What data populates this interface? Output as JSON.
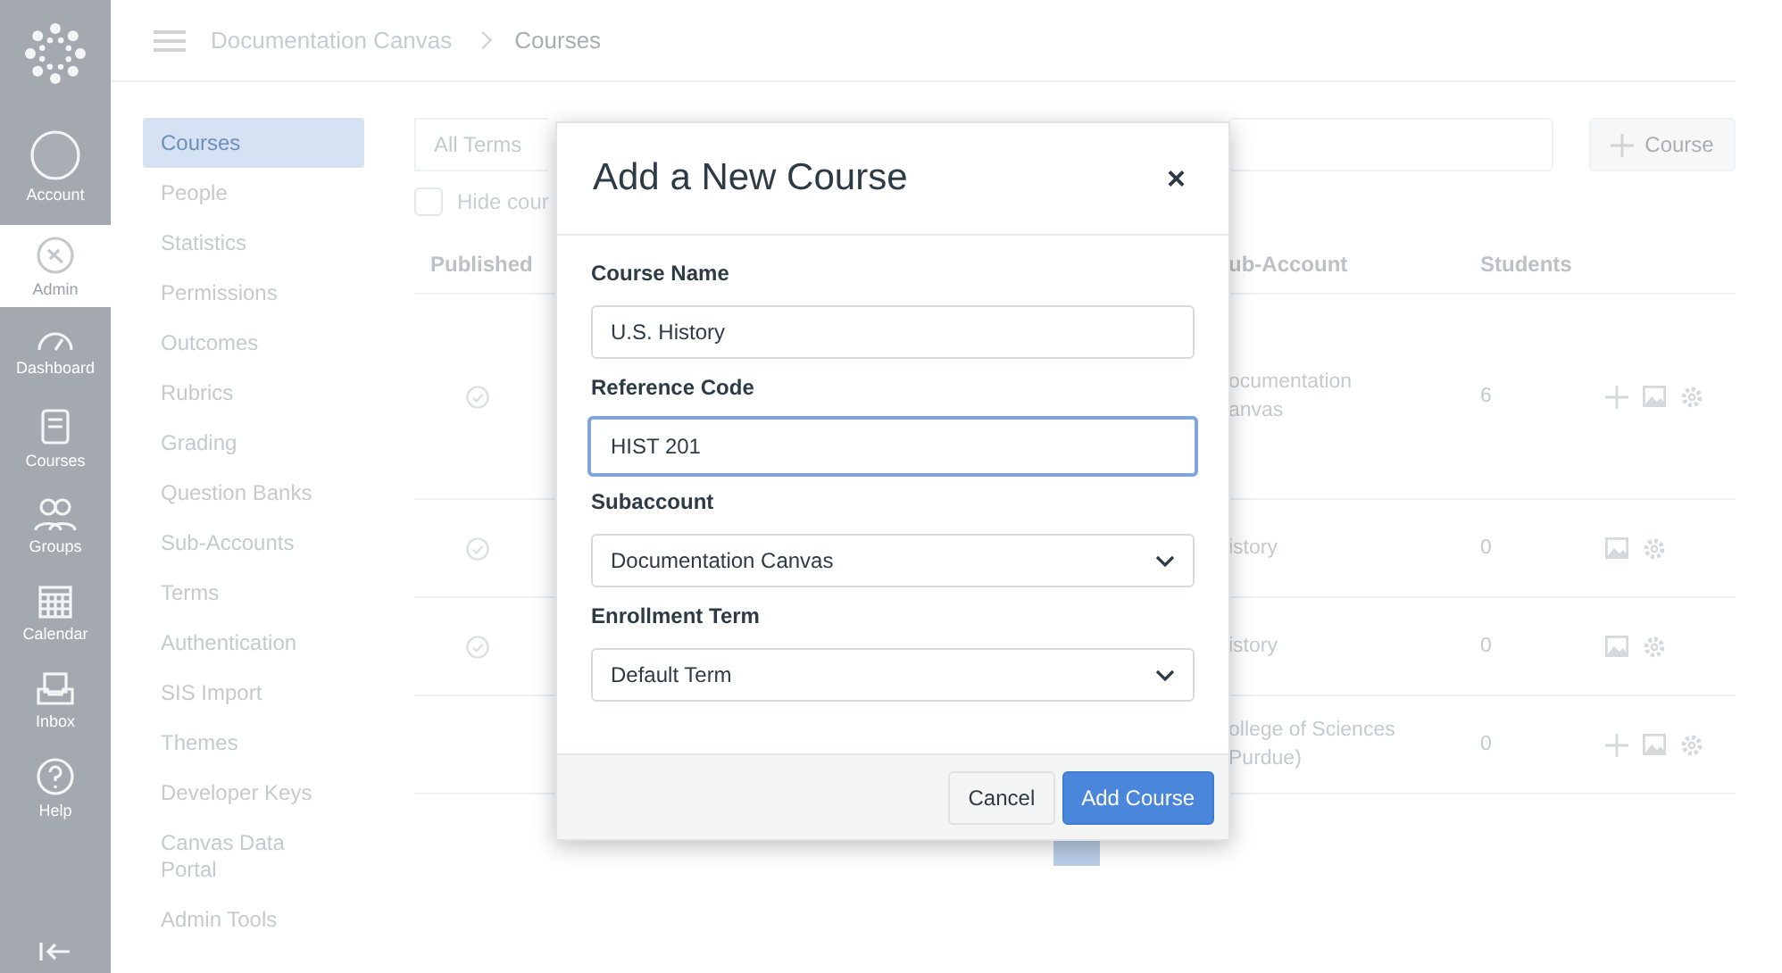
{
  "global_nav": {
    "items": [
      {
        "kind": "logo",
        "selected": false
      },
      {
        "kind": "account",
        "label": "Account",
        "selected": false
      },
      {
        "kind": "admin",
        "label": "Admin",
        "selected": true
      },
      {
        "kind": "dashboard",
        "label": "Dashboard",
        "selected": false
      },
      {
        "kind": "courses",
        "label": "Courses",
        "selected": false
      },
      {
        "kind": "groups",
        "label": "Groups",
        "selected": false
      },
      {
        "kind": "calendar",
        "label": "Calendar",
        "selected": false
      },
      {
        "kind": "inbox",
        "label": "Inbox",
        "selected": false
      },
      {
        "kind": "help",
        "label": "Help",
        "selected": false
      },
      {
        "kind": "collapse",
        "selected": false
      }
    ]
  },
  "breadcrumb": [
    "Documentation Canvas",
    "Courses"
  ],
  "sub_nav": {
    "items": [
      {
        "label": "Courses",
        "selected": true
      },
      {
        "label": "People",
        "selected": false
      },
      {
        "label": "Statistics",
        "selected": false
      },
      {
        "label": "Permissions",
        "selected": false
      },
      {
        "label": "Outcomes",
        "selected": false
      },
      {
        "label": "Rubrics",
        "selected": false
      },
      {
        "label": "Grading",
        "selected": false
      },
      {
        "label": "Question Banks",
        "selected": false
      },
      {
        "label": "Sub-Accounts",
        "selected": false
      },
      {
        "label": "Terms",
        "selected": false
      },
      {
        "label": "Authentication",
        "selected": false
      },
      {
        "label": "SIS Import",
        "selected": false
      },
      {
        "label": "Themes",
        "selected": false
      },
      {
        "label": "Developer Keys",
        "selected": false
      },
      {
        "label": "Canvas Data Portal",
        "selected": false
      },
      {
        "label": "Admin Tools",
        "selected": false
      }
    ]
  },
  "filters": {
    "term_select": "All Terms",
    "hide_checkbox": {
      "label": "Hide cour",
      "checked": false
    },
    "add_button": "Course"
  },
  "table": {
    "columns": [
      "Published",
      "ub-Account",
      "Students"
    ],
    "rows": [
      {
        "published": true,
        "sub_account": [
          "ocumentation",
          "anvas"
        ],
        "students": "6",
        "actions": [
          {
            "kind": "add"
          },
          {
            "kind": "image"
          },
          {
            "kind": "settings"
          }
        ]
      },
      {
        "published": true,
        "sub_account": [
          "istory"
        ],
        "students": "0",
        "actions": [
          {
            "kind": "image"
          },
          {
            "kind": "settings"
          }
        ]
      },
      {
        "published": true,
        "sub_account": [
          "istory"
        ],
        "students": "0",
        "actions": [
          {
            "kind": "image"
          },
          {
            "kind": "settings"
          }
        ]
      },
      {
        "published": false,
        "sub_account": [
          "ollege of Sciences",
          "Purdue)"
        ],
        "students": "0",
        "actions": [
          {
            "kind": "add"
          },
          {
            "kind": "image"
          },
          {
            "kind": "settings"
          }
        ]
      }
    ]
  },
  "modal": {
    "title": "Add a New Course",
    "close": "×",
    "fields": [
      {
        "label": "Course Name",
        "kind": "text",
        "value": "U.S. History",
        "focused": false
      },
      {
        "label": "Reference Code",
        "kind": "text",
        "value": "HIST 201",
        "focused": true
      },
      {
        "label": "Subaccount",
        "kind": "select",
        "value": "Documentation Canvas",
        "focused": false
      },
      {
        "label": "Enrollment Term",
        "kind": "select",
        "value": "Default Term",
        "focused": false
      }
    ],
    "buttons": [
      {
        "label": "Cancel",
        "kind": "secondary"
      },
      {
        "label": "Add Course",
        "kind": "primary"
      }
    ]
  }
}
